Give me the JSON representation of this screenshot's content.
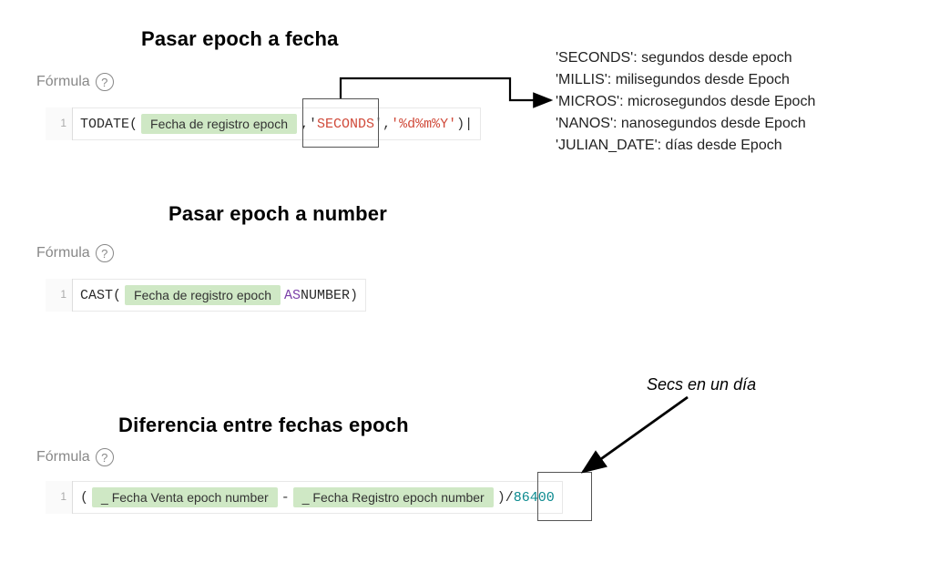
{
  "section1": {
    "heading": "Pasar epoch a fecha",
    "formula_label": "Fórmula",
    "help_glyph": "?",
    "gutter": "1",
    "func": "TODATE(",
    "chip": "Fecha de registro epoch",
    "comma1": ",",
    "sq1": "'",
    "arg2": "SECONDS",
    "sq2": "'",
    "comma2": ",",
    "arg3": "'%d%m%Y'",
    "close": ")|"
  },
  "units_list": {
    "l1_key": "'SECONDS'",
    "l1_rest": ": segundos desde epoch",
    "l2_key": "'MILLIS'",
    "l2_rest": ": milisegundos desde Epoch",
    "l3_key": "'MICROS'",
    "l3_rest": ": microsegundos desde Epoch",
    "l4_key": "'NANOS'",
    "l4_rest": ": nanosegundos desde Epoch",
    "l5_key": "'JULIAN_DATE'",
    "l5_rest": ": días desde Epoch"
  },
  "section2": {
    "heading": "Pasar epoch a number",
    "formula_label": "Fórmula",
    "help_glyph": "?",
    "gutter": "1",
    "func": "CAST(",
    "chip": "Fecha de registro epoch",
    "kw": " AS ",
    "type": "NUMBER",
    "close": ")"
  },
  "section3": {
    "heading": "Diferencia entre fechas epoch",
    "formula_label": "Fórmula",
    "help_glyph": "?",
    "gutter": "1",
    "open": "(",
    "chip1": "_ Fecha Venta epoch number",
    "minus": " - ",
    "chip2": "_ Fecha Registro epoch number",
    "close_div": ")/",
    "divisor": "86400",
    "caption": "Secs en un día"
  }
}
